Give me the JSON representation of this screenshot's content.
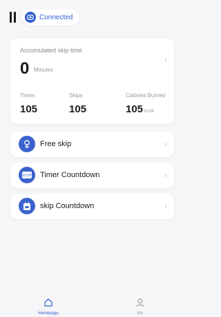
{
  "header": {
    "connection_status": "Connected"
  },
  "summary": {
    "title": "Accumulated skip time",
    "value": "0",
    "unit": "Minutes",
    "stats": [
      {
        "label": "Times",
        "value": "105",
        "unit": ""
      },
      {
        "label": "Skips",
        "value": "105",
        "unit": ""
      },
      {
        "label": "Calories Burned",
        "value": "105",
        "unit": "Kcal"
      }
    ]
  },
  "modes": [
    {
      "label": "Free skip",
      "icon": "rope-icon"
    },
    {
      "label": "Timer Countdown",
      "icon": "timer-icon",
      "icon_text": "01:00"
    },
    {
      "label": "skip Countdown",
      "icon": "count-icon"
    }
  ],
  "tabs": [
    {
      "label": "Homepage",
      "icon": "home-icon",
      "active": true
    },
    {
      "label": "Me",
      "icon": "person-icon",
      "active": false
    }
  ],
  "colors": {
    "accent": "#2f5fd0",
    "icon_bg": "#3b62cd",
    "background": "#f5f6f8"
  }
}
